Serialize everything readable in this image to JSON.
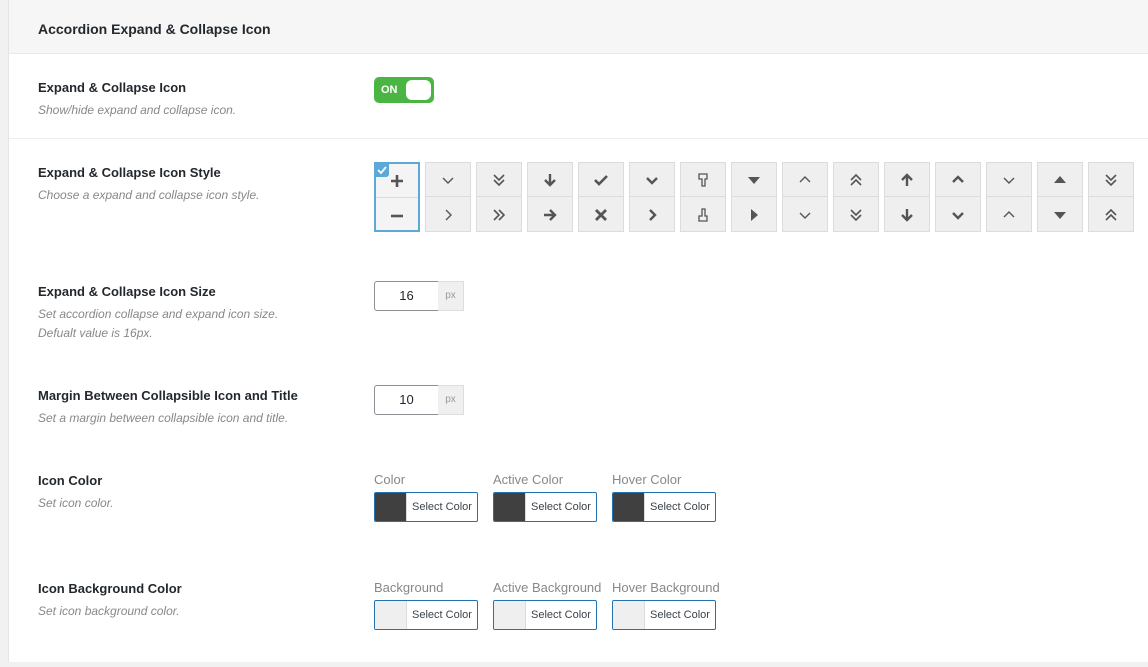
{
  "section": {
    "title": "Accordion Expand & Collapse Icon"
  },
  "colors": {
    "toggle_on": "#4bb543",
    "selected_border": "#5aa9d6",
    "swatch_dark": "#404040",
    "swatch_light": "#efefef"
  },
  "expand_collapse": {
    "title": "Expand & Collapse Icon",
    "description": "Show/hide expand and collapse icon.",
    "toggle": {
      "label": "ON",
      "state": true
    }
  },
  "icon_style": {
    "title": "Expand & Collapse Icon Style",
    "description": "Choose a expand and collapse icon style.",
    "selected_index": 0,
    "options": [
      {
        "expand": "plus-icon",
        "collapse": "minus-icon"
      },
      {
        "expand": "chevron-down-icon",
        "collapse": "chevron-right-icon"
      },
      {
        "expand": "double-chevron-down-icon",
        "collapse": "double-chevron-right-icon"
      },
      {
        "expand": "arrow-down-icon",
        "collapse": "arrow-right-icon"
      },
      {
        "expand": "check-icon",
        "collapse": "times-icon"
      },
      {
        "expand": "chevron-down-bold-icon",
        "collapse": "chevron-right-bold-icon"
      },
      {
        "expand": "hand-down-icon",
        "collapse": "hand-up-icon"
      },
      {
        "expand": "caret-down-icon",
        "collapse": "caret-right-icon"
      },
      {
        "expand": "chevron-up-icon",
        "collapse": "chevron-down-icon"
      },
      {
        "expand": "double-chevron-up-icon",
        "collapse": "double-chevron-down-icon"
      },
      {
        "expand": "arrow-up-icon",
        "collapse": "arrow-down-icon"
      },
      {
        "expand": "chevron-up-bold-icon",
        "collapse": "chevron-down-bold-icon"
      },
      {
        "expand": "chevron-down-icon",
        "collapse": "chevron-up-icon"
      },
      {
        "expand": "caret-up-icon",
        "collapse": "caret-down-icon"
      },
      {
        "expand": "double-chevron-down-icon",
        "collapse": "double-chevron-up-icon"
      }
    ]
  },
  "icon_size": {
    "title": "Expand & Collapse Icon Size",
    "description_line1": "Set accordion collapse and expand icon size.",
    "description_line2": "Defualt value is 16px.",
    "value": "16",
    "unit": "px"
  },
  "icon_margin": {
    "title": "Margin Between Collapsible Icon and Title",
    "description": "Set a margin between collapsible icon and title.",
    "value": "10",
    "unit": "px"
  },
  "icon_color": {
    "title": "Icon Color",
    "description": "Set icon color.",
    "pickers": [
      {
        "caption": "Color",
        "button": "Select Color",
        "swatch": "#404040"
      },
      {
        "caption": "Active Color",
        "button": "Select Color",
        "swatch": "#404040"
      },
      {
        "caption": "Hover Color",
        "button": "Select Color",
        "swatch": "#404040"
      }
    ]
  },
  "icon_bg_color": {
    "title": "Icon Background Color",
    "description": "Set icon background color.",
    "pickers": [
      {
        "caption": "Background",
        "button": "Select Color",
        "swatch": "#efefef"
      },
      {
        "caption": "Active Background",
        "button": "Select Color",
        "swatch": "#efefef"
      },
      {
        "caption": "Hover Background",
        "button": "Select Color",
        "swatch": "#efefef"
      }
    ]
  }
}
